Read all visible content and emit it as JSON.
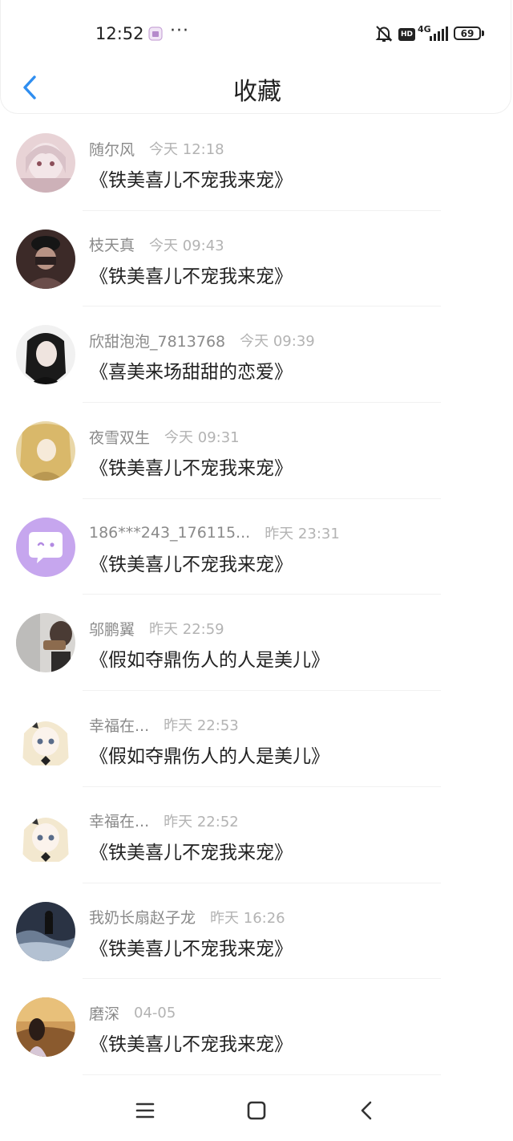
{
  "status_bar": {
    "time": "12:52",
    "more": "···",
    "hd": "HD",
    "network": "4G",
    "battery": "69"
  },
  "header": {
    "title": "收藏"
  },
  "items": [
    {
      "name": "随尔风",
      "time": "今天 12:18",
      "message": "《铁美喜儿不宠我来宠》",
      "avatar": "avatar-pink"
    },
    {
      "name": "枝天真",
      "time": "今天 09:43",
      "message": "《铁美喜儿不宠我来宠》",
      "avatar": "avatar-dark"
    },
    {
      "name": "欣甜泡泡_7813768",
      "time": "今天 09:39",
      "message": "《喜美来场甜甜的恋爱》",
      "avatar": "avatar-bw"
    },
    {
      "name": "夜雪双生",
      "time": "今天 09:31",
      "message": "《铁美喜儿不宠我来宠》",
      "avatar": "avatar-gold"
    },
    {
      "name": "186***243_176115...",
      "time": "昨天 23:31",
      "message": "《铁美喜儿不宠我来宠》",
      "avatar": "avatar-default"
    },
    {
      "name": "邬鹏翼",
      "time": "昨天 22:59",
      "message": "《假如夺鼎伤人的人是美儿》",
      "avatar": "avatar-photo"
    },
    {
      "name": "幸福在...",
      "time": "昨天 22:53",
      "message": "《假如夺鼎伤人的人是美儿》",
      "avatar": "avatar-anime"
    },
    {
      "name": "幸福在...",
      "time": "昨天 22:52",
      "message": "《铁美喜儿不宠我来宠》",
      "avatar": "avatar-anime"
    },
    {
      "name": "我奶长扇赵子龙",
      "time": "昨天 16:26",
      "message": "《铁美喜儿不宠我来宠》",
      "avatar": "avatar-night"
    },
    {
      "name": "磨深",
      "time": "04-05",
      "message": "《铁美喜儿不宠我来宠》",
      "avatar": "avatar-sunset"
    }
  ],
  "colors": {
    "accent": "#2f8ef0",
    "name_gray": "#8a8a8a",
    "time_gray": "#b3b3b3",
    "default_avatar": "#c6a6ee"
  },
  "icons": {
    "back": "chevron-left-icon",
    "menu": "menu-icon",
    "home": "home-square-icon",
    "navback": "back-triangle-icon"
  }
}
